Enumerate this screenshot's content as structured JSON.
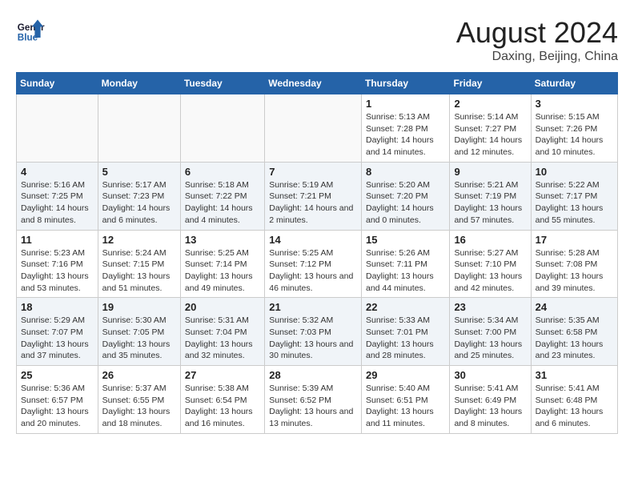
{
  "header": {
    "logo_line1": "General",
    "logo_line2": "Blue",
    "month": "August 2024",
    "location": "Daxing, Beijing, China"
  },
  "weekdays": [
    "Sunday",
    "Monday",
    "Tuesday",
    "Wednesday",
    "Thursday",
    "Friday",
    "Saturday"
  ],
  "weeks": [
    [
      {
        "day": "",
        "info": ""
      },
      {
        "day": "",
        "info": ""
      },
      {
        "day": "",
        "info": ""
      },
      {
        "day": "",
        "info": ""
      },
      {
        "day": "1",
        "info": "Sunrise: 5:13 AM\nSunset: 7:28 PM\nDaylight: 14 hours and 14 minutes."
      },
      {
        "day": "2",
        "info": "Sunrise: 5:14 AM\nSunset: 7:27 PM\nDaylight: 14 hours and 12 minutes."
      },
      {
        "day": "3",
        "info": "Sunrise: 5:15 AM\nSunset: 7:26 PM\nDaylight: 14 hours and 10 minutes."
      }
    ],
    [
      {
        "day": "4",
        "info": "Sunrise: 5:16 AM\nSunset: 7:25 PM\nDaylight: 14 hours and 8 minutes."
      },
      {
        "day": "5",
        "info": "Sunrise: 5:17 AM\nSunset: 7:23 PM\nDaylight: 14 hours and 6 minutes."
      },
      {
        "day": "6",
        "info": "Sunrise: 5:18 AM\nSunset: 7:22 PM\nDaylight: 14 hours and 4 minutes."
      },
      {
        "day": "7",
        "info": "Sunrise: 5:19 AM\nSunset: 7:21 PM\nDaylight: 14 hours and 2 minutes."
      },
      {
        "day": "8",
        "info": "Sunrise: 5:20 AM\nSunset: 7:20 PM\nDaylight: 14 hours and 0 minutes."
      },
      {
        "day": "9",
        "info": "Sunrise: 5:21 AM\nSunset: 7:19 PM\nDaylight: 13 hours and 57 minutes."
      },
      {
        "day": "10",
        "info": "Sunrise: 5:22 AM\nSunset: 7:17 PM\nDaylight: 13 hours and 55 minutes."
      }
    ],
    [
      {
        "day": "11",
        "info": "Sunrise: 5:23 AM\nSunset: 7:16 PM\nDaylight: 13 hours and 53 minutes."
      },
      {
        "day": "12",
        "info": "Sunrise: 5:24 AM\nSunset: 7:15 PM\nDaylight: 13 hours and 51 minutes."
      },
      {
        "day": "13",
        "info": "Sunrise: 5:25 AM\nSunset: 7:14 PM\nDaylight: 13 hours and 49 minutes."
      },
      {
        "day": "14",
        "info": "Sunrise: 5:25 AM\nSunset: 7:12 PM\nDaylight: 13 hours and 46 minutes."
      },
      {
        "day": "15",
        "info": "Sunrise: 5:26 AM\nSunset: 7:11 PM\nDaylight: 13 hours and 44 minutes."
      },
      {
        "day": "16",
        "info": "Sunrise: 5:27 AM\nSunset: 7:10 PM\nDaylight: 13 hours and 42 minutes."
      },
      {
        "day": "17",
        "info": "Sunrise: 5:28 AM\nSunset: 7:08 PM\nDaylight: 13 hours and 39 minutes."
      }
    ],
    [
      {
        "day": "18",
        "info": "Sunrise: 5:29 AM\nSunset: 7:07 PM\nDaylight: 13 hours and 37 minutes."
      },
      {
        "day": "19",
        "info": "Sunrise: 5:30 AM\nSunset: 7:05 PM\nDaylight: 13 hours and 35 minutes."
      },
      {
        "day": "20",
        "info": "Sunrise: 5:31 AM\nSunset: 7:04 PM\nDaylight: 13 hours and 32 minutes."
      },
      {
        "day": "21",
        "info": "Sunrise: 5:32 AM\nSunset: 7:03 PM\nDaylight: 13 hours and 30 minutes."
      },
      {
        "day": "22",
        "info": "Sunrise: 5:33 AM\nSunset: 7:01 PM\nDaylight: 13 hours and 28 minutes."
      },
      {
        "day": "23",
        "info": "Sunrise: 5:34 AM\nSunset: 7:00 PM\nDaylight: 13 hours and 25 minutes."
      },
      {
        "day": "24",
        "info": "Sunrise: 5:35 AM\nSunset: 6:58 PM\nDaylight: 13 hours and 23 minutes."
      }
    ],
    [
      {
        "day": "25",
        "info": "Sunrise: 5:36 AM\nSunset: 6:57 PM\nDaylight: 13 hours and 20 minutes."
      },
      {
        "day": "26",
        "info": "Sunrise: 5:37 AM\nSunset: 6:55 PM\nDaylight: 13 hours and 18 minutes."
      },
      {
        "day": "27",
        "info": "Sunrise: 5:38 AM\nSunset: 6:54 PM\nDaylight: 13 hours and 16 minutes."
      },
      {
        "day": "28",
        "info": "Sunrise: 5:39 AM\nSunset: 6:52 PM\nDaylight: 13 hours and 13 minutes."
      },
      {
        "day": "29",
        "info": "Sunrise: 5:40 AM\nSunset: 6:51 PM\nDaylight: 13 hours and 11 minutes."
      },
      {
        "day": "30",
        "info": "Sunrise: 5:41 AM\nSunset: 6:49 PM\nDaylight: 13 hours and 8 minutes."
      },
      {
        "day": "31",
        "info": "Sunrise: 5:41 AM\nSunset: 6:48 PM\nDaylight: 13 hours and 6 minutes."
      }
    ]
  ]
}
